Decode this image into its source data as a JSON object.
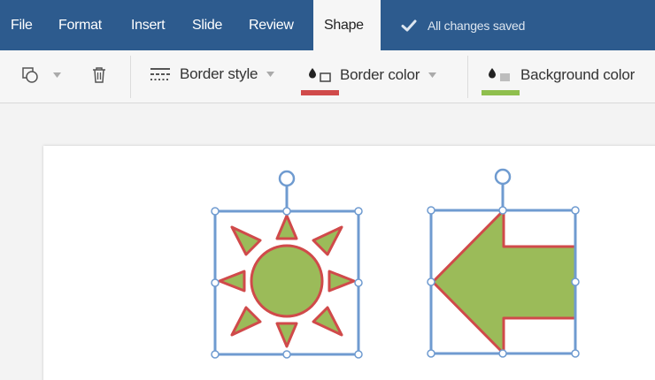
{
  "menu": {
    "items": [
      {
        "label": "File",
        "active": false
      },
      {
        "label": "Format",
        "active": false
      },
      {
        "label": "Insert",
        "active": false
      },
      {
        "label": "Slide",
        "active": false
      },
      {
        "label": "Review",
        "active": false
      },
      {
        "label": "Shape",
        "active": true
      }
    ],
    "save_status": "All changes saved",
    "save_icon": "checkmark-icon"
  },
  "toolbar": {
    "shape_icon": "shapes-icon",
    "delete_icon": "trash-icon",
    "border_style_label": "Border style",
    "border_style_icon": "border-style-icon",
    "border_color_label": "Border color",
    "border_color_icon": "border-color-icon",
    "border_color_value": "#d04a4a",
    "background_color_label": "Background color",
    "background_color_icon": "fill-color-icon",
    "background_color_value": "#8fbf4d"
  },
  "colors": {
    "menubar": "#2d5b8e",
    "shape_fill": "#9bbb59",
    "shape_stroke": "#d04a4a",
    "selection": "#6f9bd0"
  },
  "shapes": [
    {
      "name": "sun",
      "selected": true
    },
    {
      "name": "left-arrow",
      "selected": true
    }
  ]
}
